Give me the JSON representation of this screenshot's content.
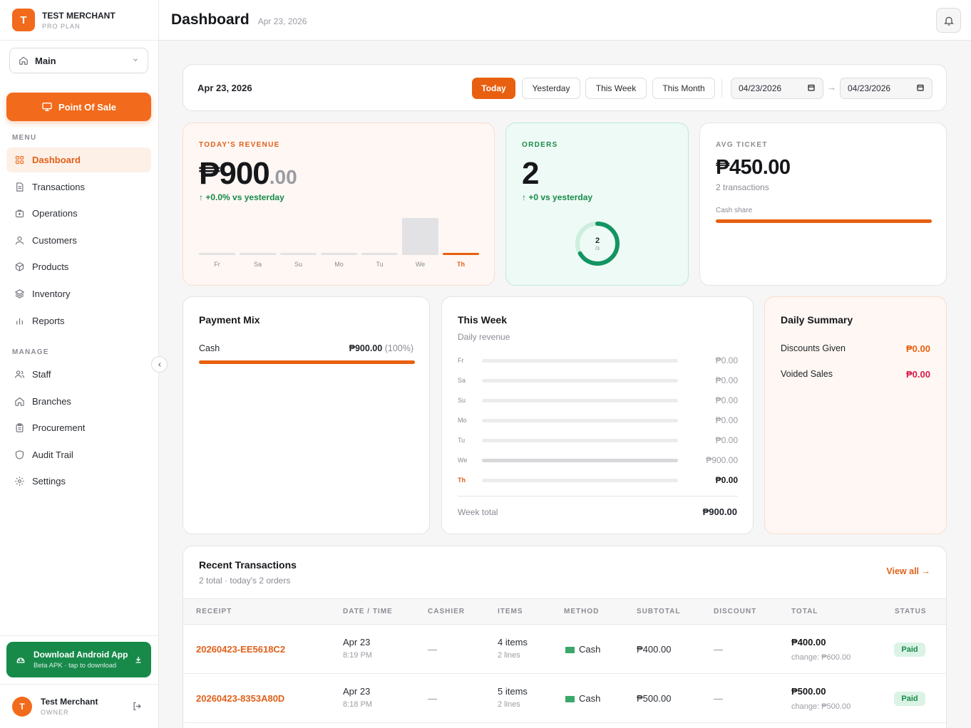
{
  "brand": {
    "initial": "T",
    "name": "TEST MERCHANT",
    "plan": "PRO PLAN"
  },
  "branch": {
    "selected": "Main"
  },
  "pos_button": "Point Of Sale",
  "menu_label": "MENU",
  "manage_label": "MANAGE",
  "menu": [
    {
      "label": "Dashboard",
      "icon": "grid-icon",
      "active": true
    },
    {
      "label": "Transactions",
      "icon": "document-icon"
    },
    {
      "label": "Operations",
      "icon": "briefcase-icon"
    },
    {
      "label": "Customers",
      "icon": "user-icon"
    },
    {
      "label": "Products",
      "icon": "cube-icon"
    },
    {
      "label": "Inventory",
      "icon": "layers-icon"
    },
    {
      "label": "Reports",
      "icon": "bar-chart-icon"
    }
  ],
  "manage": [
    {
      "label": "Staff",
      "icon": "users-icon"
    },
    {
      "label": "Branches",
      "icon": "home-icon"
    },
    {
      "label": "Procurement",
      "icon": "clipboard-icon"
    },
    {
      "label": "Audit Trail",
      "icon": "shield-icon"
    },
    {
      "label": "Settings",
      "icon": "gear-icon"
    }
  ],
  "android": {
    "title": "Download Android App",
    "subtitle": "Beta APK · tap to download"
  },
  "user": {
    "initial": "T",
    "name": "Test Merchant",
    "role": "OWNER"
  },
  "header": {
    "title": "Dashboard",
    "date": "Apr 23, 2026"
  },
  "filter": {
    "date_label": "Apr 23, 2026",
    "ranges": [
      "Today",
      "Yesterday",
      "This Week",
      "This Month"
    ],
    "active_range": "Today",
    "from": "04/23/2026",
    "to": "04/23/2026",
    "arrow": "→"
  },
  "revenue": {
    "label": "TODAY'S REVENUE",
    "whole": "₱900",
    "cents": ".00",
    "delta": "+0.0% vs yesterday",
    "days": [
      "Fr",
      "Sa",
      "Su",
      "Mo",
      "Tu",
      "We",
      "Th"
    ],
    "bars": [
      0,
      0,
      0,
      0,
      0,
      900,
      0
    ]
  },
  "orders": {
    "label": "ORDERS",
    "value": "2",
    "delta": "+0 vs yesterday",
    "ring_value": "2",
    "ring_total": "/3",
    "ring_fraction": 0.6667
  },
  "avg_ticket": {
    "label": "AVG TICKET",
    "value": "₱450.00",
    "sub": "2 transactions",
    "cash_label": "Cash share",
    "cash_share": 1.0
  },
  "payment_mix": {
    "title": "Payment Mix",
    "method": "Cash",
    "amount": "₱900.00",
    "pct": "(100%)",
    "share": 1.0
  },
  "this_week": {
    "title": "This Week",
    "subtitle": "Daily revenue",
    "rows": [
      {
        "day": "Fr",
        "value": "₱0.00"
      },
      {
        "day": "Sa",
        "value": "₱0.00"
      },
      {
        "day": "Su",
        "value": "₱0.00"
      },
      {
        "day": "Mo",
        "value": "₱0.00"
      },
      {
        "day": "Tu",
        "value": "₱0.00"
      },
      {
        "day": "We",
        "value": "₱900.00"
      },
      {
        "day": "Th",
        "value": "₱0.00"
      }
    ],
    "total_label": "Week total",
    "total": "₱900.00"
  },
  "daily_summary": {
    "title": "Daily Summary",
    "discounts_label": "Discounts Given",
    "discounts": "₱0.00",
    "voided_label": "Voided Sales",
    "voided": "₱0.00"
  },
  "recent": {
    "title": "Recent Transactions",
    "subtitle": "2 total · today's 2 orders",
    "view_all": "View all →",
    "columns": [
      "RECEIPT",
      "DATE / TIME",
      "CASHIER",
      "ITEMS",
      "METHOD",
      "SUBTOTAL",
      "DISCOUNT",
      "TOTAL",
      "STATUS"
    ],
    "rows": [
      {
        "receipt": "20260423-EE5618C2",
        "date": "Apr 23",
        "time": "8:19 PM",
        "cashier": "—",
        "items": "4 items",
        "lines": "2 lines",
        "method": "Cash",
        "subtotal": "₱400.00",
        "discount": "—",
        "total": "₱400.00",
        "change": "change: ₱600.00",
        "status": "Paid"
      },
      {
        "receipt": "20260423-8353A80D",
        "date": "Apr 23",
        "time": "8:18 PM",
        "cashier": "—",
        "items": "5 items",
        "lines": "2 lines",
        "method": "Cash",
        "subtotal": "₱500.00",
        "discount": "—",
        "total": "₱500.00",
        "change": "change: ₱500.00",
        "status": "Paid"
      }
    ]
  },
  "colors": {
    "accent": "#f26a1b",
    "success": "#178a4a",
    "danger": "#d81b4a"
  }
}
